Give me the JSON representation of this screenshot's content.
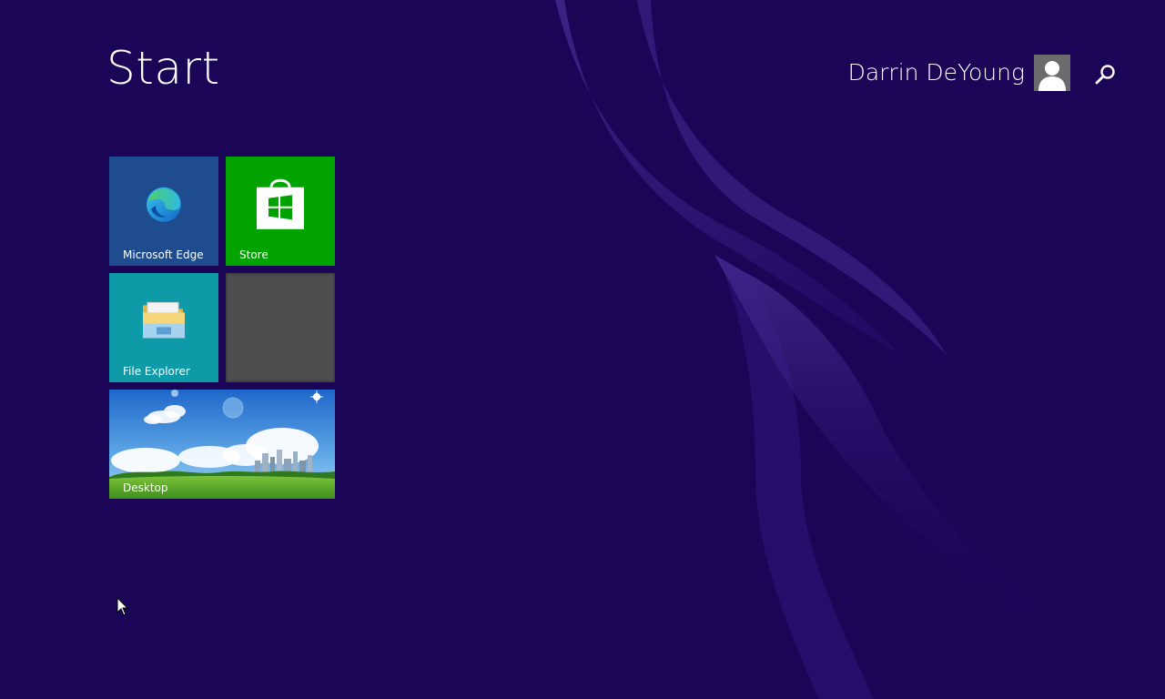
{
  "screen": {
    "title": "Start",
    "background_color": "#1a0557"
  },
  "user": {
    "name": "Darrin DeYoung",
    "avatar_icon": "person-icon"
  },
  "search": {
    "icon": "search-icon"
  },
  "tiles": [
    {
      "id": "edge",
      "label": "Microsoft Edge",
      "icon": "edge-icon",
      "color": "#1e4c8f"
    },
    {
      "id": "store",
      "label": "Store",
      "icon": "store-bag-icon",
      "color": "#00a300"
    },
    {
      "id": "explorer",
      "label": "File Explorer",
      "icon": "folder-icon",
      "color": "#0f9aa8"
    },
    {
      "id": "empty",
      "label": "",
      "icon": "",
      "color": "#4d4d4f"
    },
    {
      "id": "desktop",
      "label": "Desktop",
      "icon": "desktop-wallpaper",
      "color": "#2f6fc7"
    }
  ]
}
